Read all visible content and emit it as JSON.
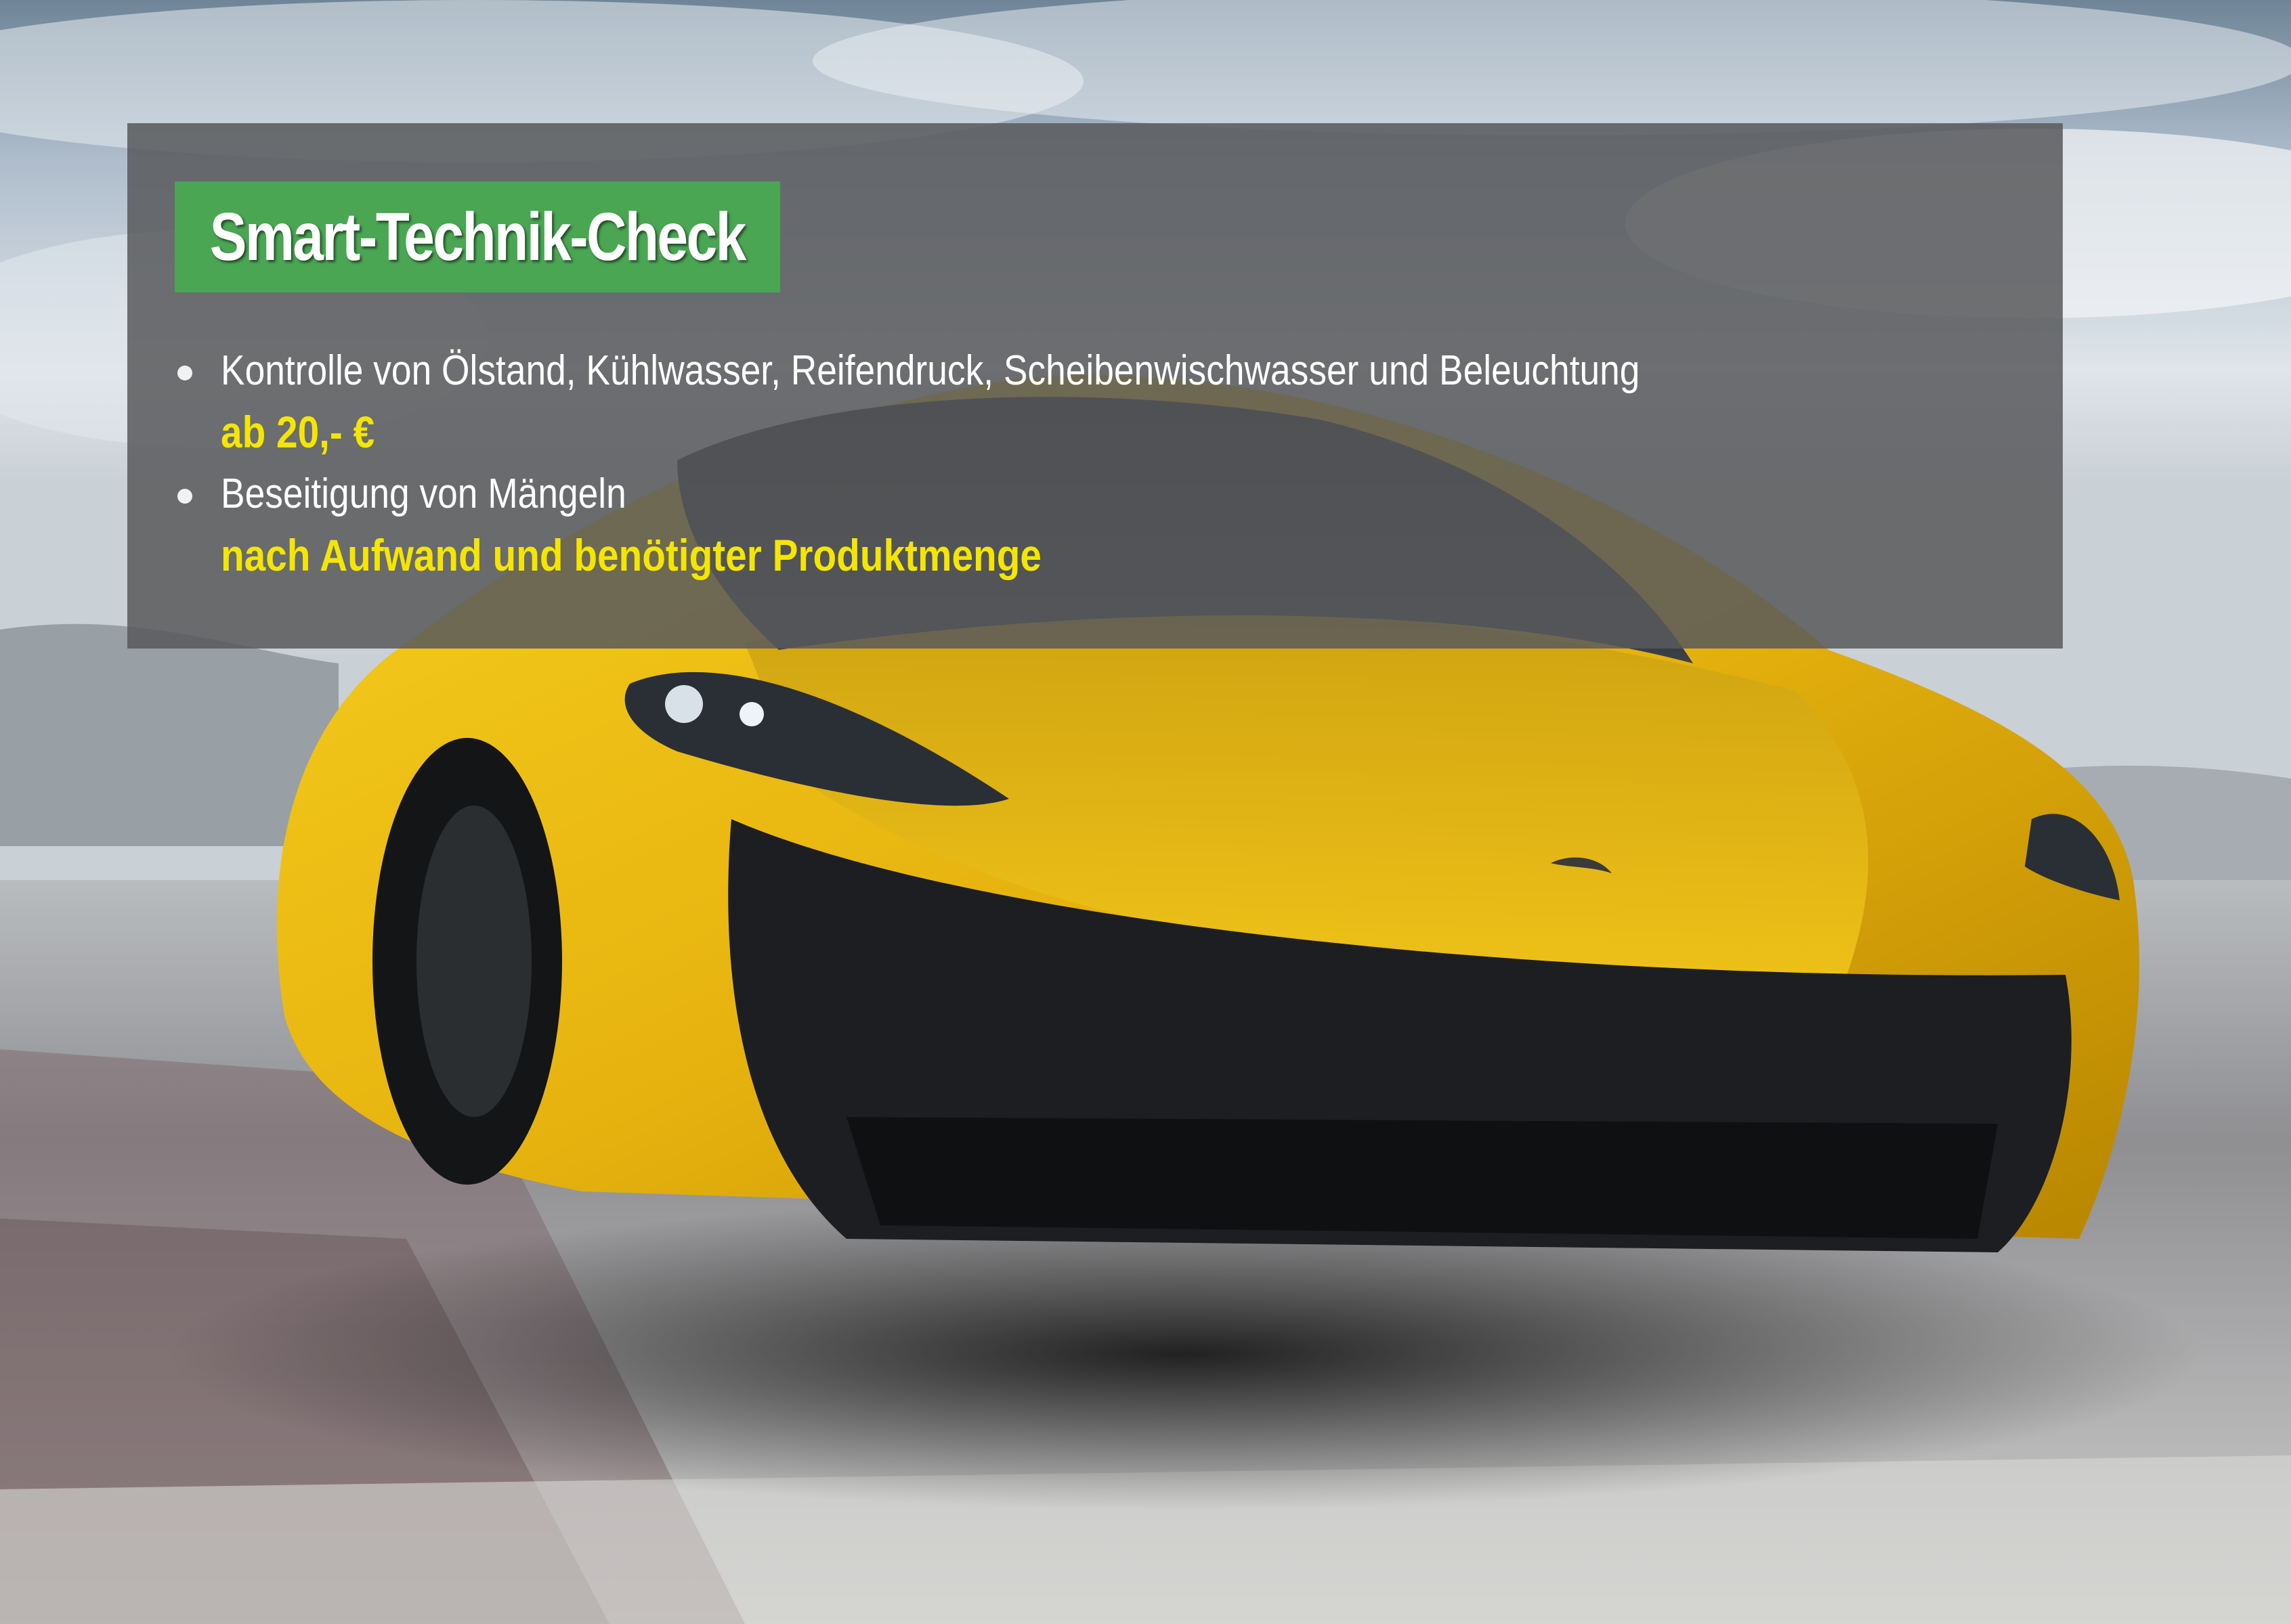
{
  "title": "Smart-Technik-Check",
  "items": [
    {
      "text": "Kontrolle von Ölstand, Kühlwasser, Reifendruck, Scheibenwischwasser und Beleuchtung",
      "price": "ab 20,- €"
    },
    {
      "text": "Beseitigung von Mängeln",
      "price": "nach Aufwand und benötigter Produktmenge"
    }
  ],
  "colors": {
    "title_background": "#4aa653",
    "price_text": "#f4e600",
    "panel": "#585a5c",
    "car_body": "#e7b40f"
  },
  "background_image": "yellow-sports-car-on-track"
}
